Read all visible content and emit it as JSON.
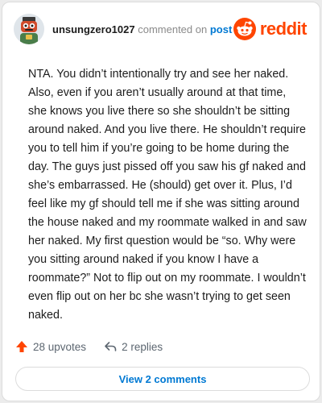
{
  "header": {
    "username": "unsungzero1027",
    "commented_on": "commented on",
    "post_link": "post",
    "brand_name": "reddit",
    "avatar_icon": "robot-avatar-icon",
    "brand_icon": "reddit-snoo-icon"
  },
  "comment": {
    "text": "NTA. You didn’t intentionally try and see her naked. Also, even if you aren’t usually around at that time, she knows you live there so she shouldn’t be sitting around naked. And you live there. He shouldn’t require you to tell him if you’re going to be home during the day. The guys just pissed off you saw his gf naked and she’s embarrassed. He (should) get over it. Plus, I’d feel like my gf should tell me if she was sitting around the house naked and my roommate walked in and saw her naked. My first question would be “so. Why were you sitting around naked if you know I have a roommate?” Not to flip out on my roommate. I wouldn’t even flip out on her bc she wasn’t trying to get seen naked."
  },
  "actions": {
    "upvotes_label": "28 upvotes",
    "replies_label": "2 replies",
    "upvote_icon": "upvote-arrow-icon",
    "reply_icon": "reply-arrow-icon"
  },
  "footer": {
    "view_comments_label": "View 2 comments"
  },
  "colors": {
    "brand": "#ff4500",
    "link": "#0079d3",
    "upvote": "#ff4500"
  }
}
